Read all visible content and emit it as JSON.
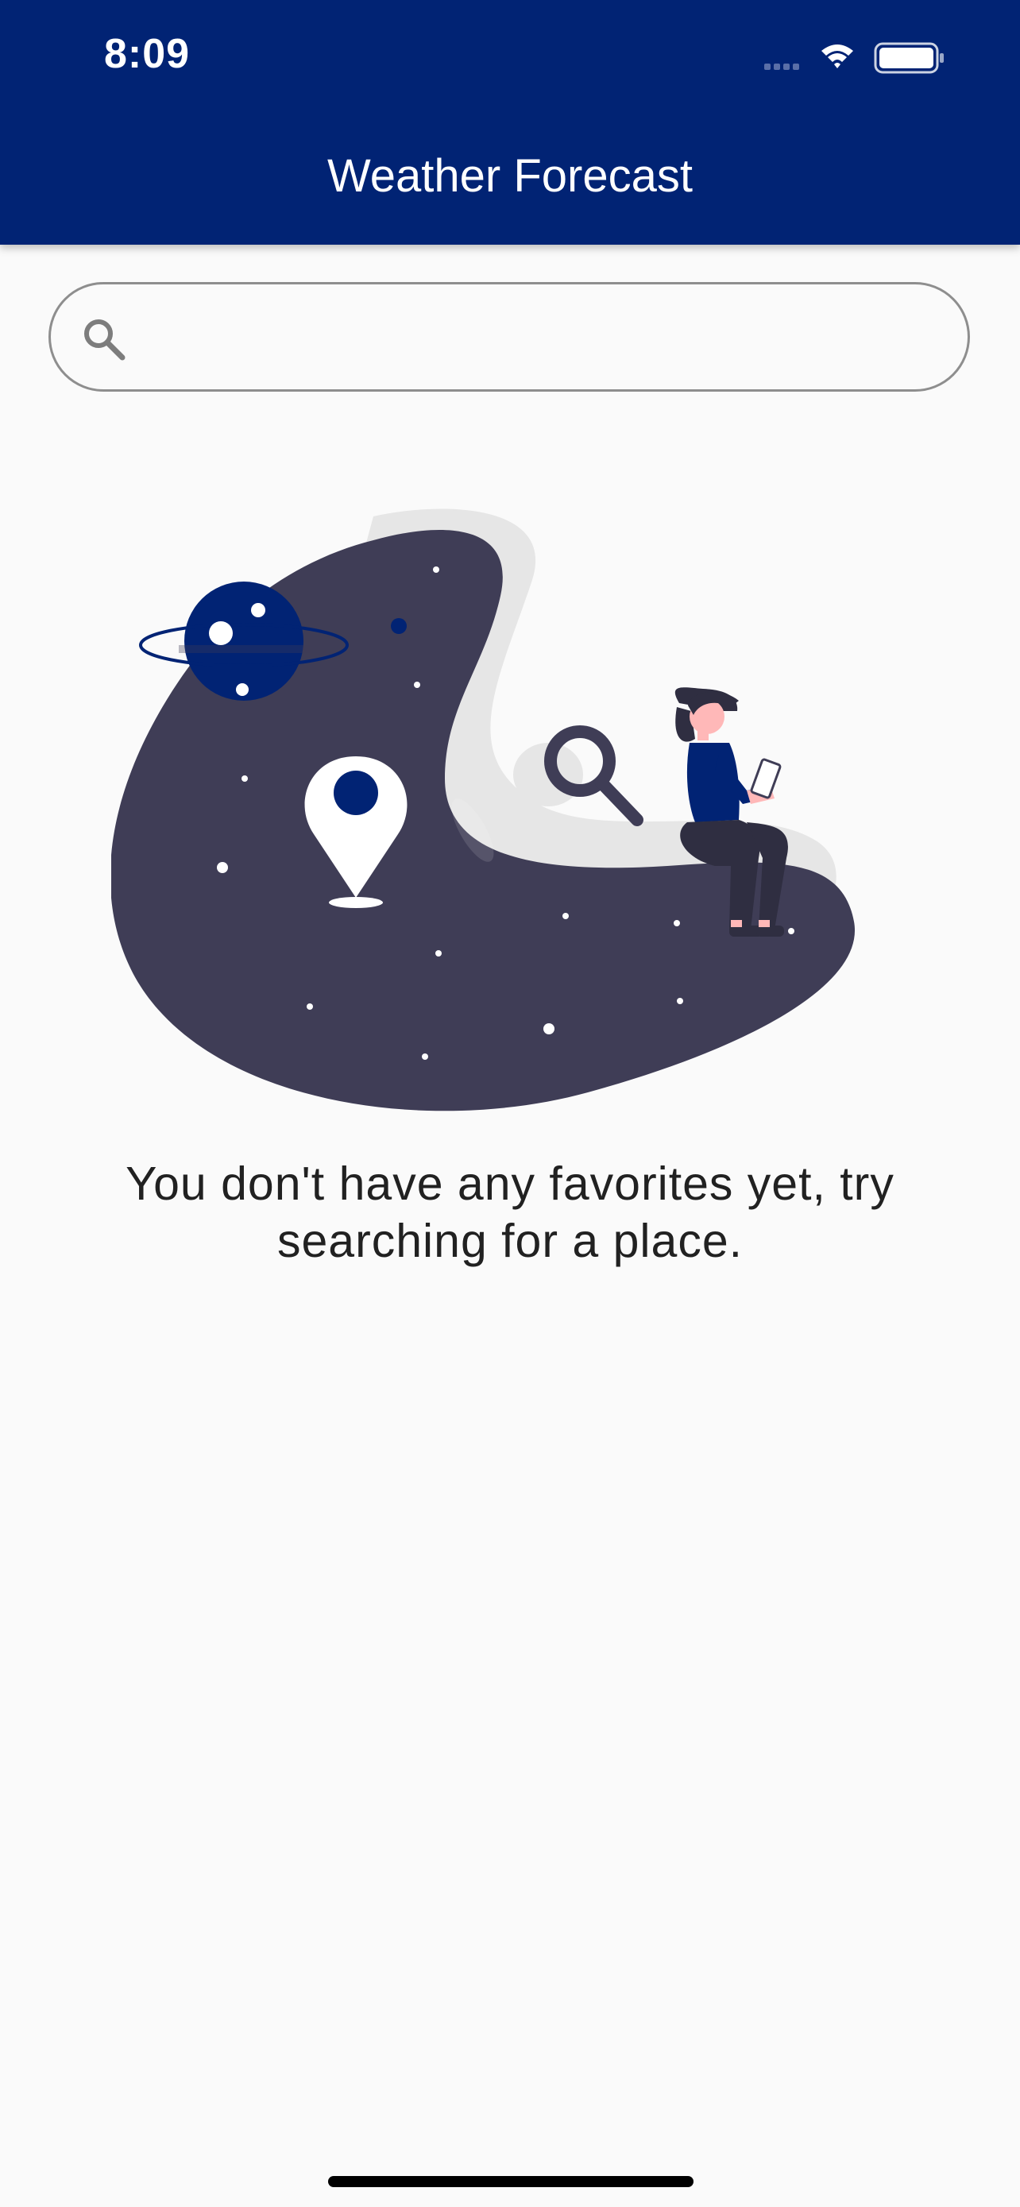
{
  "status_bar": {
    "time": "8:09",
    "icons": [
      "cellular-signal-icon",
      "wifi-icon",
      "battery-icon"
    ]
  },
  "app_bar": {
    "title": "Weather Forecast"
  },
  "search": {
    "placeholder": "",
    "value": "",
    "icon": "search-icon"
  },
  "empty_state": {
    "illustration": "empty-favorites-illustration",
    "message": "You don't have any favorites yet, try searching for a place."
  },
  "colors": {
    "primary": "#012374",
    "background": "#fafafa",
    "illustration_dark": "#3f3d56",
    "text": "#212121"
  }
}
